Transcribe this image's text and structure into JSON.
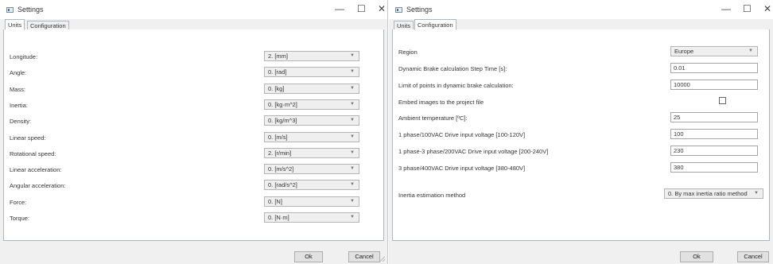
{
  "left_window": {
    "title": "Settings",
    "tabs": [
      "Units",
      "Configuration"
    ],
    "rows": [
      {
        "label": "Longitude:",
        "value": "2. [mm]"
      },
      {
        "label": "Angle:",
        "value": "0. [rad]"
      },
      {
        "label": "Mass:",
        "value": "0. [kg]"
      },
      {
        "label": "Inertia:",
        "value": "0. [kg·m^2]"
      },
      {
        "label": "Density:",
        "value": "0. [kg/m^3]"
      },
      {
        "label": "Linear speed:",
        "value": "0. [m/s]"
      },
      {
        "label": "Rotational speed:",
        "value": "2. [r/min]"
      },
      {
        "label": "Linear acceleration:",
        "value": "0. [m/s^2]"
      },
      {
        "label": "Angular acceleration:",
        "value": "0. [rad/s^2]"
      },
      {
        "label": "Force:",
        "value": "0. [N]"
      },
      {
        "label": "Torque:",
        "value": "0. [N·m]"
      }
    ],
    "ok_label": "Ok",
    "cancel_label": "Cancel",
    "controls": {
      "minimize": "—",
      "maximize": "☐",
      "close": "✕"
    }
  },
  "right_window": {
    "title": "Settings",
    "tabs": [
      "Units",
      "Configuration"
    ],
    "region": {
      "label": "Region",
      "value": "Europe"
    },
    "step_time": {
      "label": "Dynamic Brake calculation Step Time [s]:",
      "value": "0.01"
    },
    "limit_points": {
      "label": "Limit of points in dynamic brake calculation:",
      "value": "10000"
    },
    "embed_images": {
      "label": "Embed images to the project file",
      "checked": false
    },
    "ambient_temp": {
      "label": "Ambient temperature [ºC]:",
      "value": "25"
    },
    "voltage_100": {
      "label": "1 phase/100VAC Drive input voltage [100-120V]",
      "value": "100"
    },
    "voltage_200": {
      "label": "1 phase-3 phase/200VAC Drive input voltage [200-240V]",
      "value": "230"
    },
    "voltage_400": {
      "label": "3 phase/400VAC Drive input voltage [380-480V]",
      "value": "380"
    },
    "inertia_method": {
      "label": "Inertia estimation method",
      "value": "0. By max inertia ratio method"
    },
    "ok_label": "Ok",
    "cancel_label": "Cancel",
    "controls": {
      "minimize": "—",
      "maximize": "☐",
      "close": "✕"
    }
  }
}
